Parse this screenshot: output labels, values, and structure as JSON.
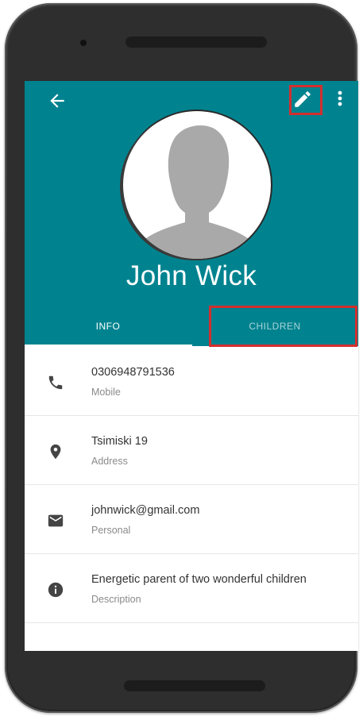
{
  "colors": {
    "primary": "#00838f",
    "highlight": "#d32f2f",
    "tab_inactive": "#a8d3d7"
  },
  "toolbar": {
    "back_icon": "arrow-left-icon",
    "edit_icon": "pencil-icon",
    "more_icon": "more-vert-icon"
  },
  "profile": {
    "name": "John Wick",
    "avatar_icon": "person-silhouette-icon"
  },
  "tabs": [
    {
      "label": "INFO",
      "active": true
    },
    {
      "label": "CHILDREN",
      "active": false
    }
  ],
  "details": [
    {
      "icon": "phone-icon",
      "value": "0306948791536",
      "label": "Mobile"
    },
    {
      "icon": "location-pin-icon",
      "value": "Tsimiski 19",
      "label": "Address"
    },
    {
      "icon": "email-icon",
      "value": "johnwick@gmail.com",
      "label": "Personal"
    },
    {
      "icon": "info-icon",
      "value": "Energetic parent of two wonderful children",
      "label": "Description"
    }
  ]
}
